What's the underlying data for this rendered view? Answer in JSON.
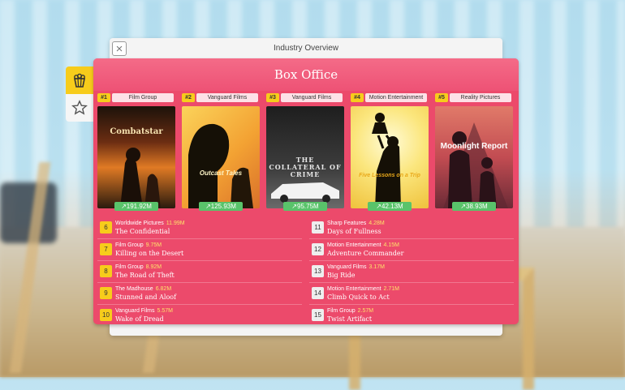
{
  "window": {
    "title": "Industry Overview",
    "close_label": "×"
  },
  "side_tabs": [
    {
      "name": "popcorn-tab",
      "icon": "popcorn-icon"
    },
    {
      "name": "star-tab",
      "icon": "star-icon"
    }
  ],
  "panel": {
    "title": "Box Office"
  },
  "top_films": [
    {
      "rank": "#1",
      "studio": "Film Group",
      "title": "Combatstar",
      "gross": "191.92M",
      "colors": [
        "#2a1a0e",
        "#d96a1c"
      ]
    },
    {
      "rank": "#2",
      "studio": "Vanguard Films",
      "title": "Outcast Tales",
      "gross": "125.93M",
      "colors": [
        "#f5b23a",
        "#e8822a"
      ]
    },
    {
      "rank": "#3",
      "studio": "Vanguard Films",
      "title": "THE COLLATERAL OF CRIME",
      "gross": "95.75M",
      "colors": [
        "#2e2e2e",
        "#5a5a5a"
      ]
    },
    {
      "rank": "#4",
      "studio": "Motion Entertainment",
      "title": "Five Lessons on a Trip",
      "gross": "42.13M",
      "colors": [
        "#fff3a8",
        "#f1c83c"
      ]
    },
    {
      "rank": "#5",
      "studio": "Reality Pictures",
      "title": "Moonlight Report",
      "gross": "38.93M",
      "colors": [
        "#d8645c",
        "#5b2a35"
      ]
    }
  ],
  "list_left": [
    {
      "num": "6",
      "studio": "Worldwide Pictures",
      "gross": "11.99M",
      "title": "The Confidential"
    },
    {
      "num": "7",
      "studio": "Film Group",
      "gross": "9.75M",
      "title": "Killing on the Desert"
    },
    {
      "num": "8",
      "studio": "Film Group",
      "gross": "8.92M",
      "title": "The Road of Theft"
    },
    {
      "num": "9",
      "studio": "The Madhouse",
      "gross": "6.82M",
      "title": "Stunned and Aloof"
    },
    {
      "num": "10",
      "studio": "Vanguard Films",
      "gross": "5.57M",
      "title": "Wake of Dread"
    }
  ],
  "list_right": [
    {
      "num": "11",
      "studio": "Sharp Features",
      "gross": "4.28M",
      "title": "Days of Fullness"
    },
    {
      "num": "12",
      "studio": "Motion Entertainment",
      "gross": "4.15M",
      "title": "Adventure Commander"
    },
    {
      "num": "13",
      "studio": "Vanguard Films",
      "gross": "3.17M",
      "title": "Big Ride"
    },
    {
      "num": "14",
      "studio": "Motion Entertainment",
      "gross": "2.71M",
      "title": "Climb Quick to Act"
    },
    {
      "num": "15",
      "studio": "Film Group",
      "gross": "2.57M",
      "title": "Twist Artifact"
    }
  ]
}
